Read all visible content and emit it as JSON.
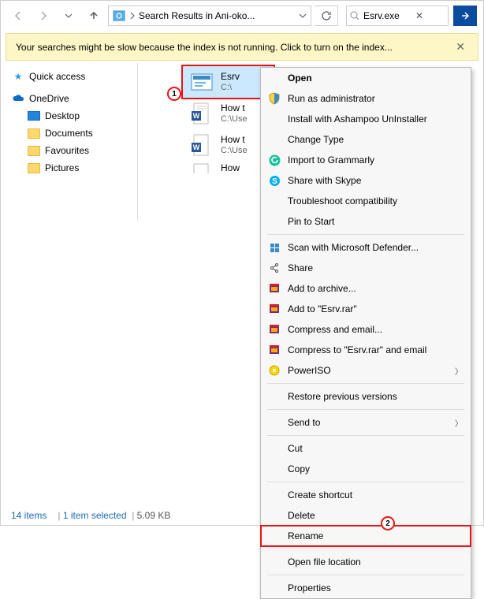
{
  "toolbar": {
    "address_text": "Search Results in Ani-oko...",
    "search_value": "Esrv.exe"
  },
  "infobar": {
    "message": "Your searches might be slow because the index is not running.  Click to turn on the index..."
  },
  "sidebar": {
    "quick_access": "Quick access",
    "onedrive": "OneDrive",
    "items": [
      {
        "label": "Desktop"
      },
      {
        "label": "Documents"
      },
      {
        "label": "Favourites"
      },
      {
        "label": "Pictures"
      }
    ]
  },
  "files": [
    {
      "name": "Esrv",
      "sub": "C:\\"
    },
    {
      "name": "How t",
      "sub": "C:\\Use"
    },
    {
      "name": "How t",
      "sub": "C:\\Use"
    },
    {
      "name": "How",
      "sub": ""
    }
  ],
  "status": {
    "count": "14 items",
    "selected": "1 item selected",
    "size": "5.09 KB"
  },
  "callouts": {
    "one": "1",
    "two": "2"
  },
  "ctx": {
    "open": "Open",
    "runadmin": "Run as administrator",
    "ashampoo": "Install with Ashampoo UnInstaller",
    "changetype": "Change Type",
    "grammarly": "Import to Grammarly",
    "skype": "Share with Skype",
    "tshoot": "Troubleshoot compatibility",
    "pin": "Pin to Start",
    "defender": "Scan with Microsoft Defender...",
    "share": "Share",
    "addarchive": "Add to archive...",
    "addrar": "Add to \"Esrv.rar\"",
    "compemail": "Compress and email...",
    "compraremail": "Compress to \"Esrv.rar\" and email",
    "poweriso": "PowerISO",
    "restore": "Restore previous versions",
    "sendto": "Send to",
    "cut": "Cut",
    "copy": "Copy",
    "shortcut": "Create shortcut",
    "delete": "Delete",
    "rename": "Rename",
    "openloc": "Open file location",
    "props": "Properties"
  }
}
